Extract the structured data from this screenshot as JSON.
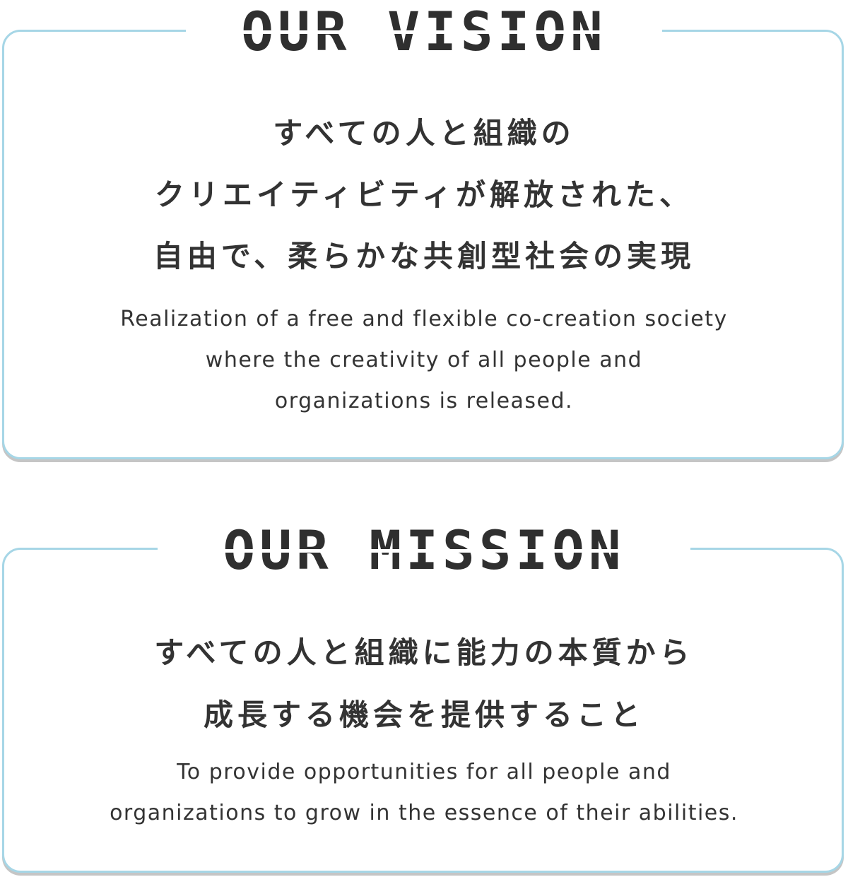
{
  "vision": {
    "heading": "OUR VISION",
    "ja_lines": [
      "すべての人と組織の",
      "クリエイティビティが解放された、",
      "自由で、柔らかな共創型社会の実現"
    ],
    "en_lines": [
      "Realization of a free and flexible co-creation society",
      "where the creativity of all people and",
      "organizations is released."
    ]
  },
  "mission": {
    "heading": "OUR MISSION",
    "ja_lines": [
      "すべての人と組織に能力の本質から",
      "成長する機会を提供すること"
    ],
    "en_lines": [
      "To provide opportunities for all people and",
      "organizations to grow in the essence of their abilities."
    ]
  },
  "colors": {
    "border": "#a6d6e6",
    "text": "#333333"
  }
}
